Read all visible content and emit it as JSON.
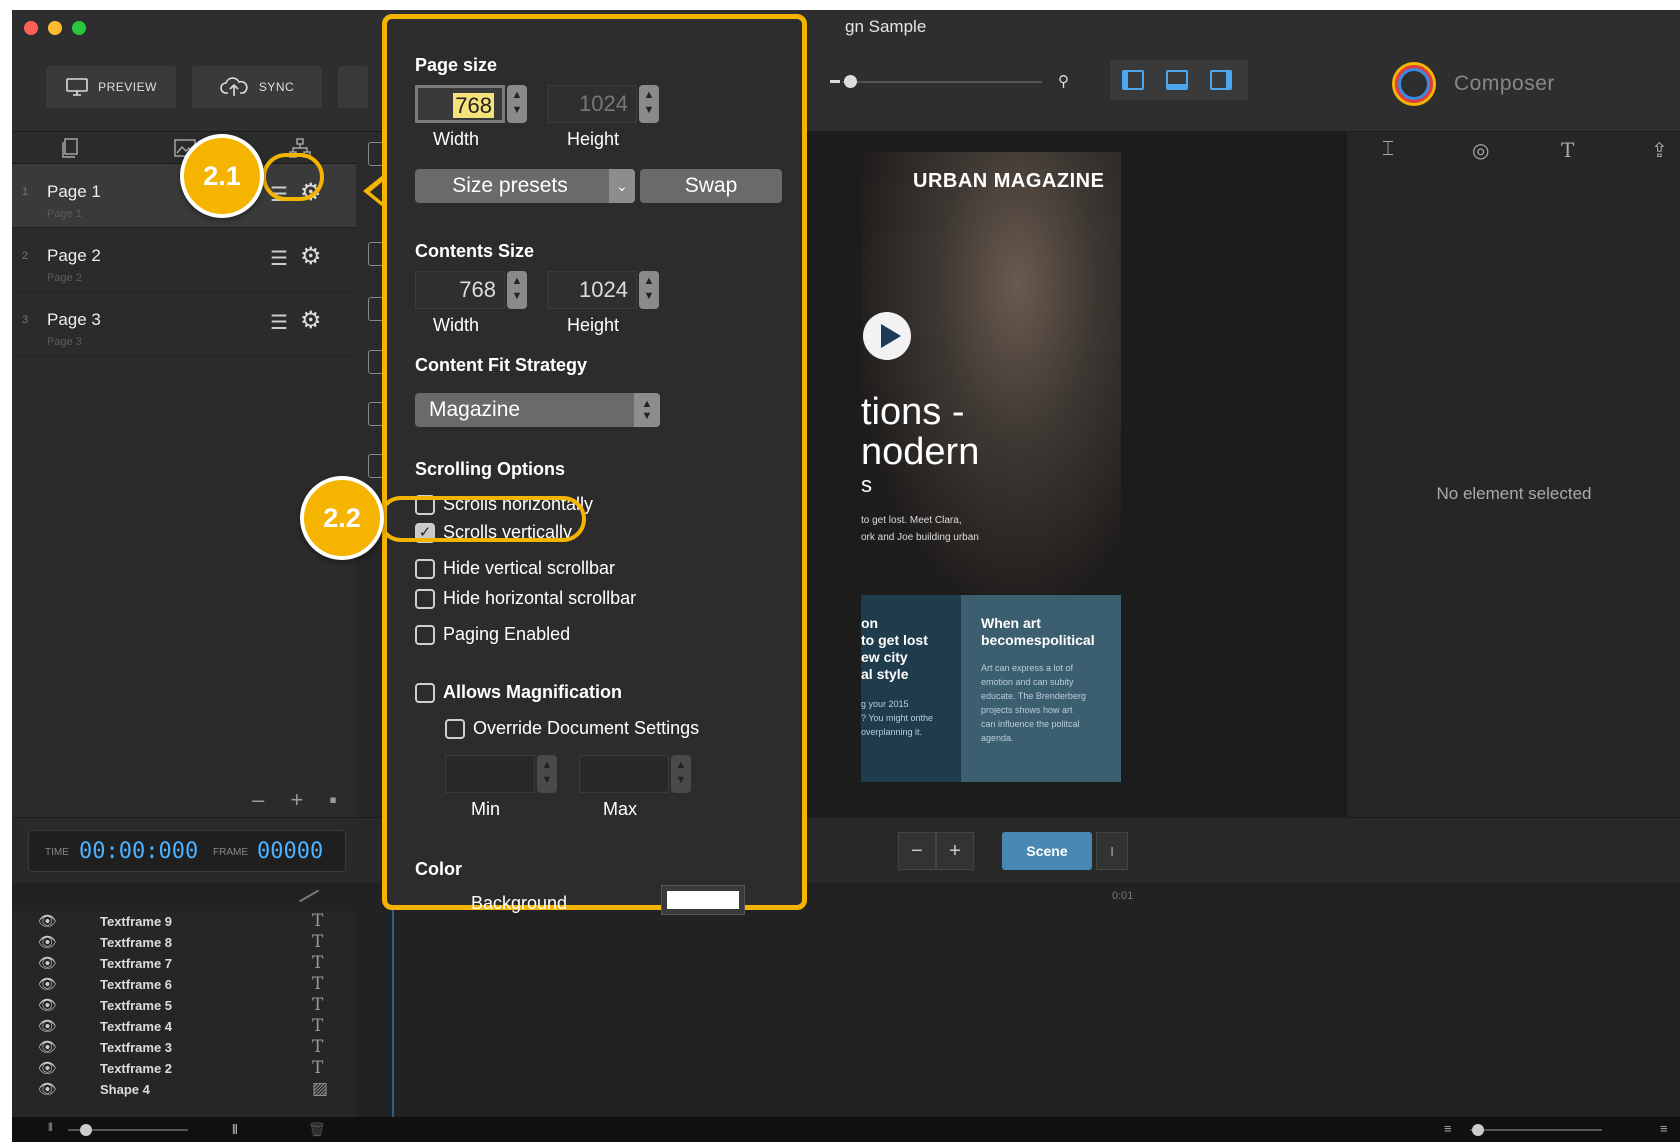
{
  "window": {
    "title": "gn Sample"
  },
  "toolbar": {
    "preview_label": "PREVIEW",
    "sync_label": "SYNC",
    "app_name": "Composer"
  },
  "sidebar": {
    "pages": [
      {
        "num": "1",
        "name": "Page 1",
        "subtitle": "Page 1"
      },
      {
        "num": "2",
        "name": "Page 2",
        "subtitle": "Page 2"
      },
      {
        "num": "3",
        "name": "Page 3",
        "subtitle": "Page 3"
      }
    ],
    "footer": "– + ▪"
  },
  "canvas": {
    "magazine_title": "URBAN MAGAZINE",
    "headline_line1": "tions -",
    "headline_line2": "nodern",
    "headline_line3": "s",
    "blurb_line1": "to get lost. Meet Clara,",
    "blurb_line2": "ork and Joe building urban",
    "col1_title": "on\nto get lost\new city\nal style",
    "col1_body": "g your 2015\n? You might onthe\noverplanning it.",
    "col2_title": "When art\nbecomespolitical",
    "col2_body": "Art can express a lot of\nemotion and can subity\neducate. The Brenderberg\nprojects shows how art\ncan influence the politcal\nagenda."
  },
  "right_panel": {
    "empty_text": "No element selected"
  },
  "timebar": {
    "time_label": "TIME",
    "time_value": "00:00:000",
    "frame_label": "FRAME",
    "frame_value": "00000",
    "scene_label": "Scene",
    "cursor_label": "I"
  },
  "timeline": {
    "marker": "0:01",
    "layers": [
      {
        "name": "Textframe 9",
        "type": "T"
      },
      {
        "name": "Textframe 8",
        "type": "T"
      },
      {
        "name": "Textframe 7",
        "type": "T"
      },
      {
        "name": "Textframe 6",
        "type": "T"
      },
      {
        "name": "Textframe 5",
        "type": "T"
      },
      {
        "name": "Textframe 4",
        "type": "T"
      },
      {
        "name": "Textframe 3",
        "type": "T"
      },
      {
        "name": "Textframe 2",
        "type": "T"
      },
      {
        "name": "Shape 4",
        "type": "▨"
      }
    ]
  },
  "popover": {
    "page_size_title": "Page size",
    "page_width": "768",
    "page_height": "1024",
    "width_label": "Width",
    "height_label": "Height",
    "size_presets_label": "Size presets",
    "swap_label": "Swap",
    "contents_size_title": "Contents Size",
    "contents_width": "768",
    "contents_height": "1024",
    "fit_strategy_title": "Content Fit Strategy",
    "fit_strategy_value": "Magazine",
    "scrolling_title": "Scrolling Options",
    "scrolls_horizontally": "Scrolls horizontally",
    "scrolls_vertically": "Scrolls vertically",
    "hide_vertical": "Hide vertical scrollbar",
    "hide_horizontal": "Hide horizontal scrollbar",
    "paging_enabled": "Paging Enabled",
    "allows_magnification": "Allows Magnification",
    "override_document": "Override Document Settings",
    "min_label": "Min",
    "max_label": "Max",
    "color_title": "Color",
    "background_label": "Background",
    "background_color": "#ffffff"
  },
  "callouts": {
    "one": "2.1",
    "two": "2.2"
  },
  "colors": {
    "accent": "#f5b400",
    "time_blue": "#4db2ff",
    "scene_blue": "#4a88b4"
  }
}
